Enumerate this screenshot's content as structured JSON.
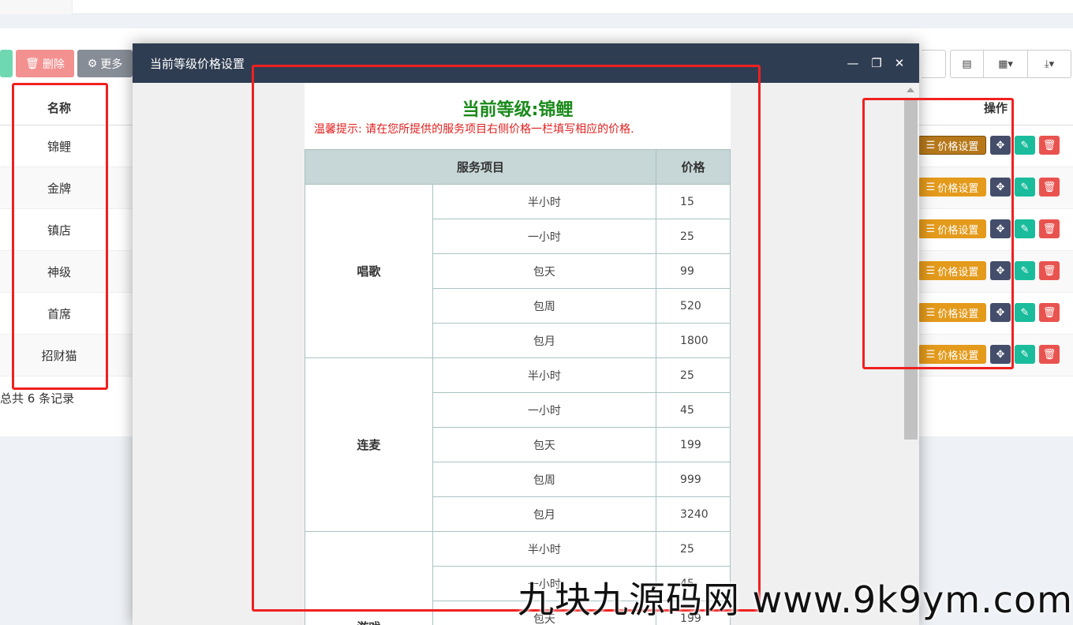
{
  "toolbar": {
    "delete_label": "删除",
    "more_label": "更多"
  },
  "table": {
    "col_name": "名称",
    "col_ops": "操作",
    "rows": [
      {
        "name": "锦鲤"
      },
      {
        "name": "金牌"
      },
      {
        "name": "镇店"
      },
      {
        "name": "神级"
      },
      {
        "name": "首席"
      },
      {
        "name": "招财猫"
      }
    ],
    "price_button_label": "价格设置",
    "total_text": "总共 6 条记录"
  },
  "modal": {
    "title": "当前等级价格设置",
    "heading": "当前等级:锦鲤",
    "tip": "温馨提示: 请在您所提供的服务项目右侧价格一栏填写相应的价格.",
    "col_service": "服务项目",
    "col_price": "价格",
    "groups": [
      {
        "name": "唱歌",
        "items": [
          {
            "duration": "半小时",
            "price": "15"
          },
          {
            "duration": "一小时",
            "price": "25"
          },
          {
            "duration": "包天",
            "price": "99"
          },
          {
            "duration": "包周",
            "price": "520"
          },
          {
            "duration": "包月",
            "price": "1800"
          }
        ]
      },
      {
        "name": "连麦",
        "items": [
          {
            "duration": "半小时",
            "price": "25"
          },
          {
            "duration": "一小时",
            "price": "45"
          },
          {
            "duration": "包天",
            "price": "199"
          },
          {
            "duration": "包周",
            "price": "999"
          },
          {
            "duration": "包月",
            "price": "3240"
          }
        ]
      },
      {
        "name": "游戏",
        "items": [
          {
            "duration": "半小时",
            "price": "25"
          },
          {
            "duration": "一小时",
            "price": "45"
          },
          {
            "duration": "包天",
            "price": "199"
          }
        ]
      }
    ]
  },
  "watermark": "九块九源码网 www.9k9ym.com",
  "colors": {
    "modal_header": "#2f3d52",
    "heading_green": "#1a8a1a",
    "tip_red": "#e02020",
    "price_button": "#e49a1b",
    "highlight_red": "#f02020"
  }
}
